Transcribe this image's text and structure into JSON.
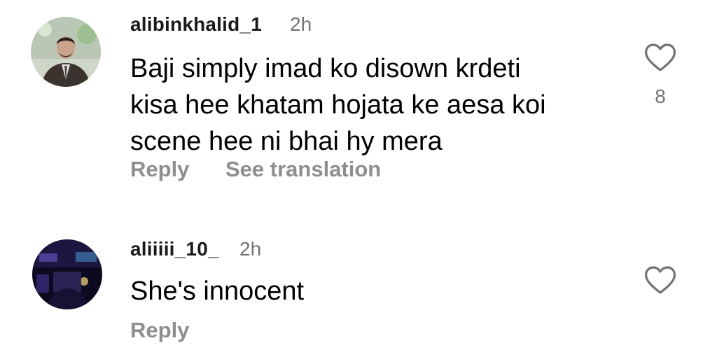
{
  "comments": [
    {
      "username": "alibinkhalid_1",
      "time": "2h",
      "text": "Baji simply imad ko disown krdeti\nkisa hee khatam hojata ke aesa koi\nscene hee ni bhai hy mera",
      "actions": {
        "reply": "Reply",
        "translate": "See translation"
      },
      "like_icon": "heart-outline-icon",
      "like_count": "8"
    },
    {
      "username": "aliiiii_10_",
      "time": "2h",
      "text": "She's innocent",
      "actions": {
        "reply": "Reply"
      },
      "like_icon": "heart-outline-icon"
    }
  ],
  "colors": {
    "meta_gray": "#737373",
    "action_gray": "#8e8e8e",
    "text": "#000000",
    "background": "#ffffff"
  }
}
